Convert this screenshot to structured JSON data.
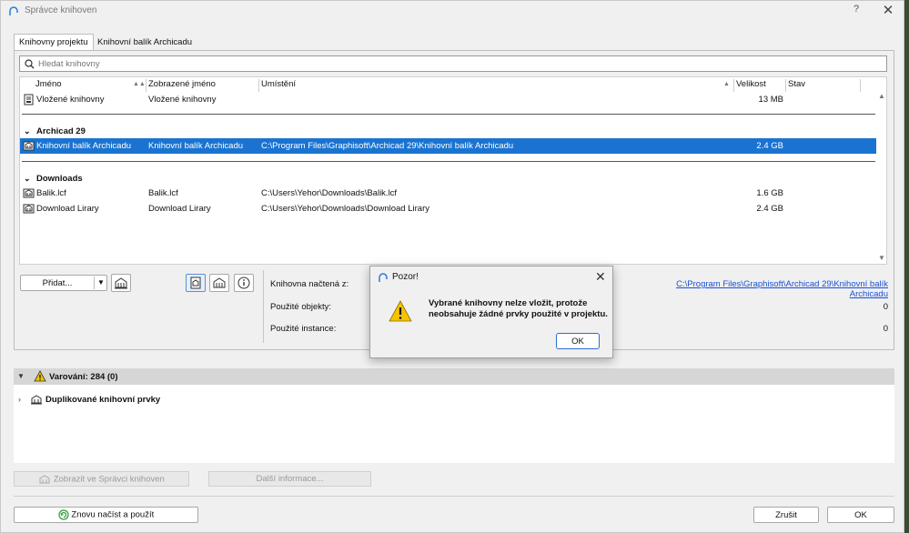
{
  "window": {
    "title": "Správce knihoven",
    "help": "?",
    "close": "✕"
  },
  "tabs": [
    {
      "label": "Knihovny projektu",
      "active": true
    },
    {
      "label": "Knihovní balík Archicadu",
      "active": false
    }
  ],
  "search": {
    "placeholder": "Hledat knihovny"
  },
  "columns": {
    "name": "Jméno",
    "display": "Zobrazené jméno",
    "location": "Umístění",
    "size": "Velikost",
    "status": "Stav"
  },
  "rows_top": [
    {
      "name": "Vložené knihovny",
      "display": "Vložené knihovny",
      "location": "",
      "size": "13 MB",
      "icon": "embedded-library-icon"
    }
  ],
  "groups": [
    {
      "label": "Archicad 29",
      "rows": [
        {
          "name": "Knihovní balík Archicadu",
          "display": "Knihovní balík Archicadu",
          "location": "C:\\Program Files\\Graphisoft\\Archicad 29\\Knihovní balík Archicadu",
          "size": "2.4 GB",
          "selected": true,
          "icon": "library-icon"
        }
      ]
    },
    {
      "label": "Downloads",
      "rows": [
        {
          "name": "Balik.lcf",
          "display": "Balik.lcf",
          "location": "C:\\Users\\Yehor\\Downloads\\Balik.lcf",
          "size": "1.6 GB",
          "icon": "library-icon"
        },
        {
          "name": "Download Lirary",
          "display": "Download Lirary",
          "location": "C:\\Users\\Yehor\\Downloads\\Download Lirary",
          "size": "2.4 GB",
          "icon": "library-icon"
        }
      ]
    }
  ],
  "actions": {
    "add": "Přidat..."
  },
  "info": {
    "loaded_from_label": "Knihovna načtená z:",
    "loaded_from_value": "C:\\Program Files\\Graphisoft\\Archicad 29\\Knihovní balík Archicadu",
    "used_objects_label": "Použité objekty:",
    "used_objects_value": "0",
    "used_instances_label": "Použité instance:",
    "used_instances_value": "0"
  },
  "warnings": {
    "header": "Varování: 284 (0)",
    "item": "Duplikované knihovní prvky"
  },
  "bottom": {
    "show_in_manager": "Zobrazit ve Správci knihoven",
    "more_info": "Další informace...",
    "reload_apply": "Znovu načíst a použít",
    "cancel": "Zrušit",
    "ok": "OK"
  },
  "dialog": {
    "title": "Pozor!",
    "message": "Vybrané knihovny nelze vložit, protože neobsahuje žádné prvky použité v projektu.",
    "ok": "OK"
  },
  "colors": {
    "selection": "#1a73d1",
    "link": "#1a4fd6",
    "warning": "#f5c400"
  }
}
